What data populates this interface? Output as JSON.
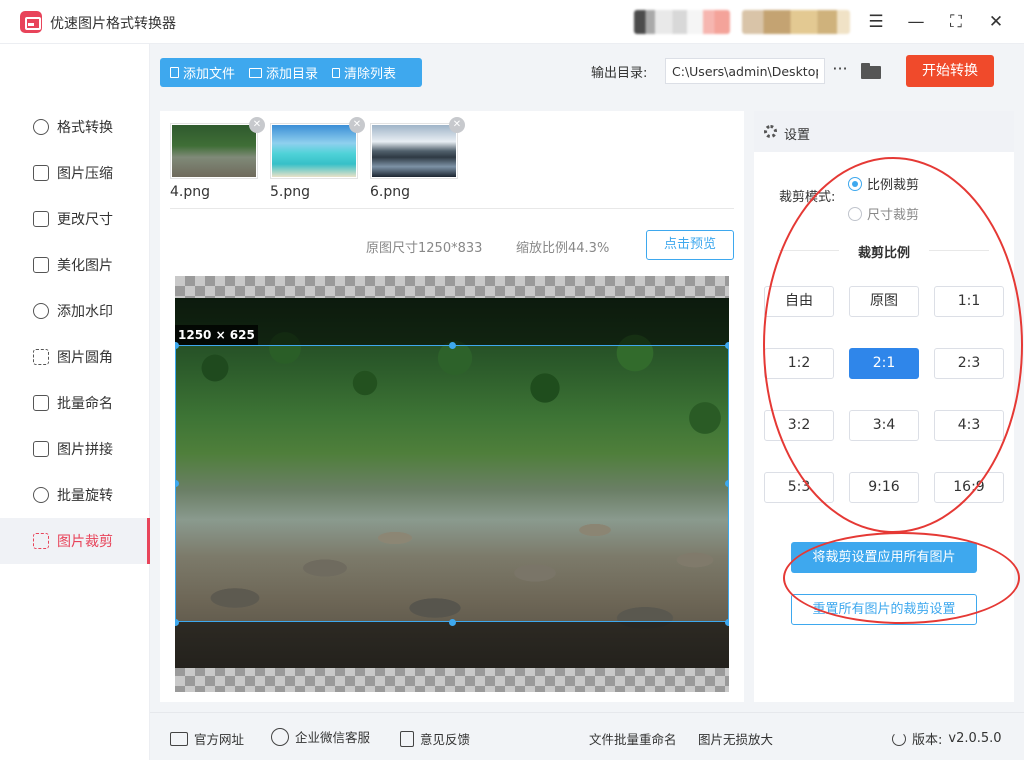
{
  "app": {
    "title": "优速图片格式转换器"
  },
  "window": {
    "menu_icon": "hamburger-icon",
    "min_icon": "minimize-icon",
    "max_icon": "maximize-icon",
    "close_icon": "close-icon"
  },
  "sidebar": {
    "items": [
      {
        "label": "格式转换",
        "icon": "format-convert-icon"
      },
      {
        "label": "图片压缩",
        "icon": "compress-icon"
      },
      {
        "label": "更改尺寸",
        "icon": "resize-icon"
      },
      {
        "label": "美化图片",
        "icon": "beautify-icon"
      },
      {
        "label": "添加水印",
        "icon": "watermark-icon"
      },
      {
        "label": "图片圆角",
        "icon": "round-corner-icon"
      },
      {
        "label": "批量命名",
        "icon": "rename-icon"
      },
      {
        "label": "图片拼接",
        "icon": "stitch-icon"
      },
      {
        "label": "批量旋转",
        "icon": "rotate-icon"
      },
      {
        "label": "图片裁剪",
        "icon": "crop-icon"
      }
    ],
    "active_index": 9,
    "active_color": "#e8445a"
  },
  "toolbar": {
    "add_file": "添加文件",
    "add_folder": "添加目录",
    "clear_list": "清除列表",
    "output_label": "输出目录:",
    "output_path": "C:\\Users\\admin\\Desktop",
    "more": "···",
    "start": "开始转换",
    "start_color": "#f04a2b",
    "accent_color": "#3ea8ee"
  },
  "files": [
    {
      "name": "4.png"
    },
    {
      "name": "5.png"
    },
    {
      "name": "6.png"
    }
  ],
  "preview": {
    "original_size": "原图尺寸1250*833",
    "zoom": "缩放比例44.3%",
    "preview_button": "点击预览",
    "crop_label": "1250 × 625"
  },
  "settings": {
    "title": "设置",
    "mode_label": "裁剪模式:",
    "mode_options": [
      "比例裁剪",
      "尺寸裁剪"
    ],
    "mode_selected": "比例裁剪",
    "ratio_title": "裁剪比例",
    "ratios": [
      "自由",
      "原图",
      "1:1",
      "1:2",
      "2:1",
      "2:3",
      "3:2",
      "3:4",
      "4:3",
      "5:3",
      "9:16",
      "16:9"
    ],
    "ratio_selected": "2:1",
    "apply_all": "将裁剪设置应用所有图片",
    "reset_all": "重置所有图片的裁剪设置",
    "annotation_color": "#e53935"
  },
  "footer": {
    "website": "官方网址",
    "wechat": "企业微信客服",
    "feedback": "意见反馈",
    "batch_rename": "文件批量重命名",
    "lossless_zoom": "图片无损放大",
    "version_label": "版本:",
    "version": "v2.0.5.0"
  }
}
